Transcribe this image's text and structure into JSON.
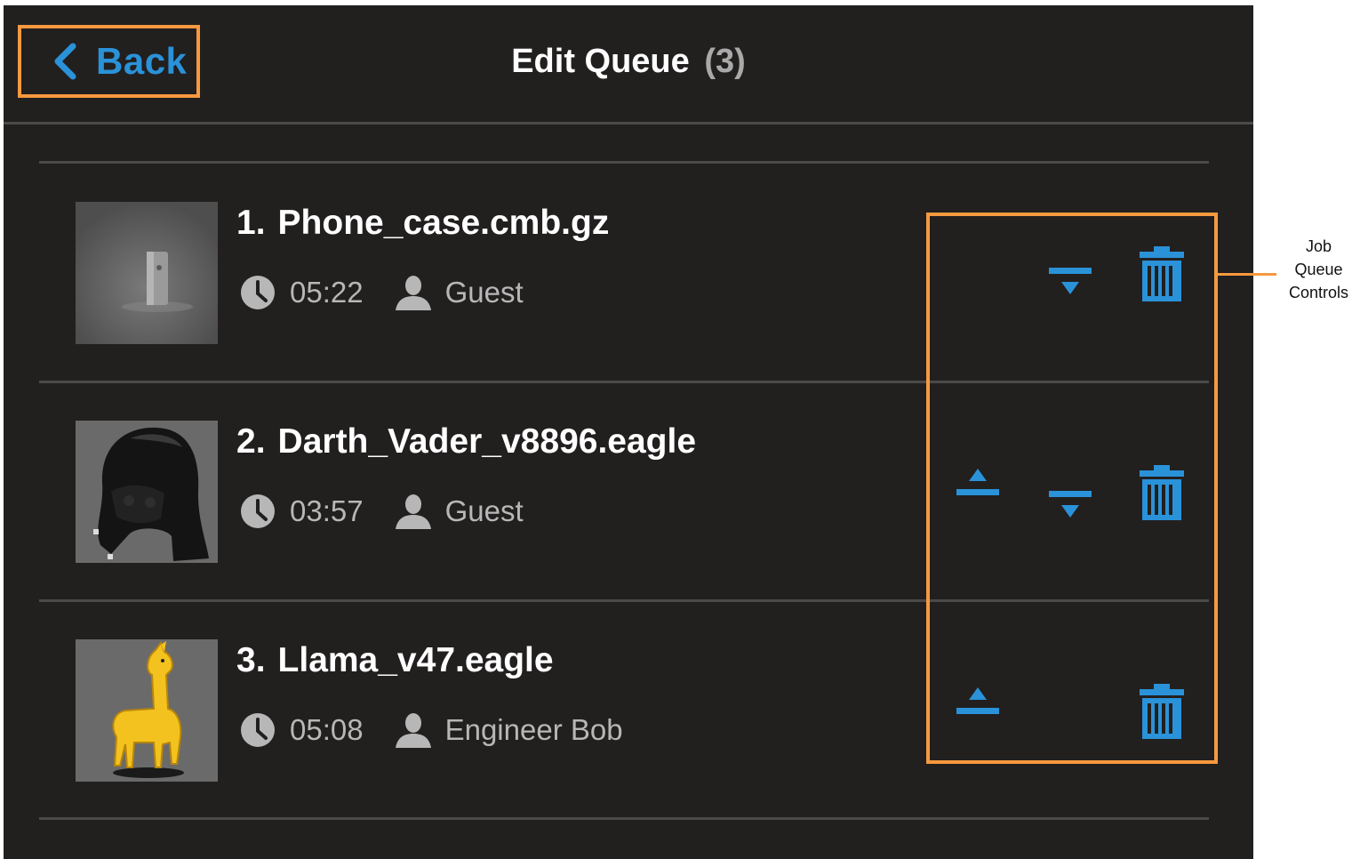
{
  "header": {
    "back_label": "Back",
    "title": "Edit Queue",
    "count": "(3)"
  },
  "jobs": [
    {
      "index": "1.",
      "name": "Phone_case.cmb.gz",
      "time": "05:22",
      "user": "Guest",
      "can_move_up": false,
      "can_move_down": true
    },
    {
      "index": "2.",
      "name": "Darth_Vader_v8896.eagle",
      "time": "03:57",
      "user": "Guest",
      "can_move_up": true,
      "can_move_down": true
    },
    {
      "index": "3.",
      "name": "Llama_v47.eagle",
      "time": "05:08",
      "user": "Engineer Bob",
      "can_move_up": true,
      "can_move_down": false
    }
  ],
  "annotation": {
    "label_lines": [
      "Job",
      "Queue",
      "Controls"
    ]
  },
  "colors": {
    "background": "#221f1f",
    "accent": "#2a92d8",
    "highlight": "#f7993f",
    "divider": "#4a4a4a"
  },
  "icons": [
    "chevron-left-icon",
    "clock-icon",
    "user-icon",
    "move-up-icon",
    "move-down-icon",
    "trash-icon"
  ]
}
